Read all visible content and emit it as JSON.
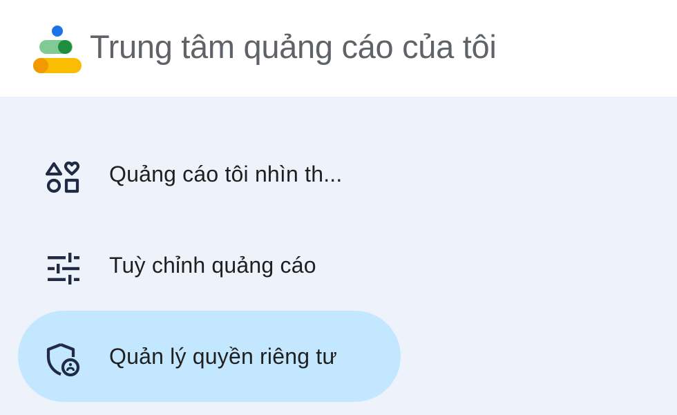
{
  "header": {
    "title": "Trung tâm quảng cáo của tôi",
    "logo_icon": "my-ad-center-logo"
  },
  "nav": {
    "items": [
      {
        "label": "Quảng cáo tôi nhìn th...",
        "icon": "shapes-icon",
        "active": false
      },
      {
        "label": "Tuỳ chỉnh quảng cáo",
        "icon": "tune-icon",
        "active": false
      },
      {
        "label": "Quản lý quyền riêng tư",
        "icon": "privacy-shield-icon",
        "active": true
      }
    ]
  },
  "colors": {
    "header_bg": "#ffffff",
    "page_bg": "#eef2fa",
    "active_bg": "#c2e7ff",
    "icon": "#1f2a44",
    "logo_blue": "#1a73e8",
    "logo_green": "#34a853",
    "logo_orange": "#f29900",
    "logo_yellow": "#fbbc04"
  }
}
